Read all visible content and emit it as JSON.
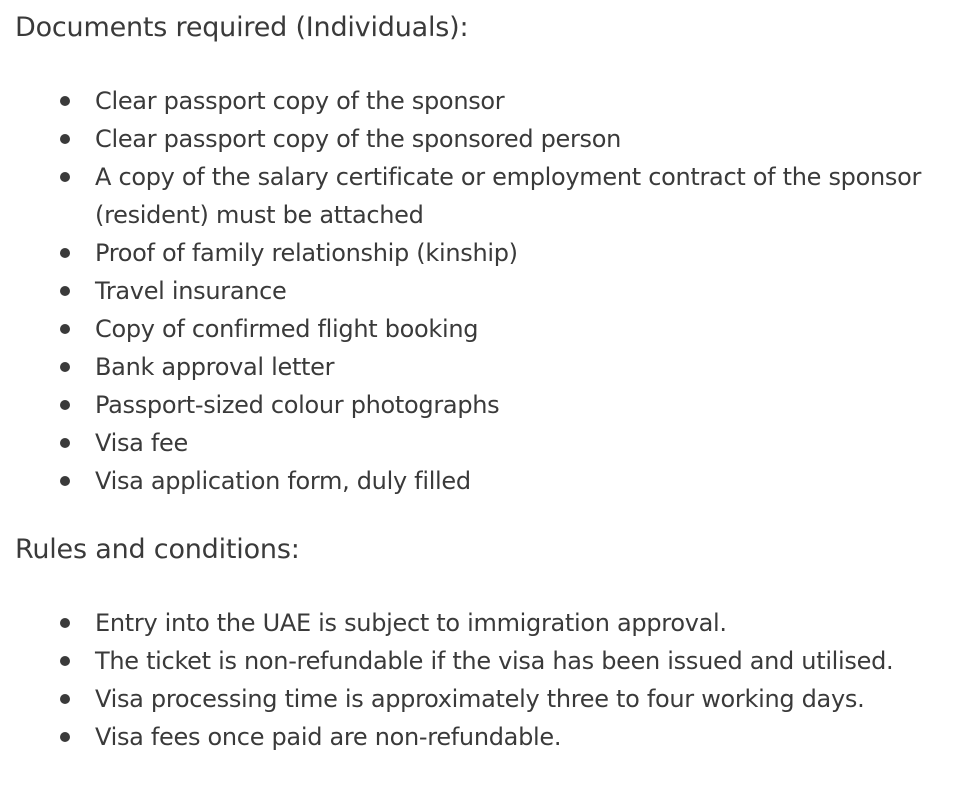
{
  "documents": {
    "heading": "Documents required (Individuals):",
    "items": [
      "Clear passport copy of the sponsor",
      "Clear passport copy of the sponsored person",
      "A copy of the salary certificate or employment contract of the sponsor (resident) must be attached",
      "Proof of family relationship (kinship)",
      "Travel insurance",
      "Copy of confirmed flight booking",
      "Bank approval letter",
      "Passport-sized colour photographs",
      "Visa fee",
      "Visa application form, duly filled"
    ]
  },
  "rules": {
    "heading": "Rules and conditions:",
    "items": [
      "Entry into the UAE is subject to immigration approval.",
      "The ticket is non-refundable if the visa has been issued and utilised.",
      "Visa processing time is approximately three to four working days.",
      "Visa fees once paid are non-refundable."
    ]
  }
}
